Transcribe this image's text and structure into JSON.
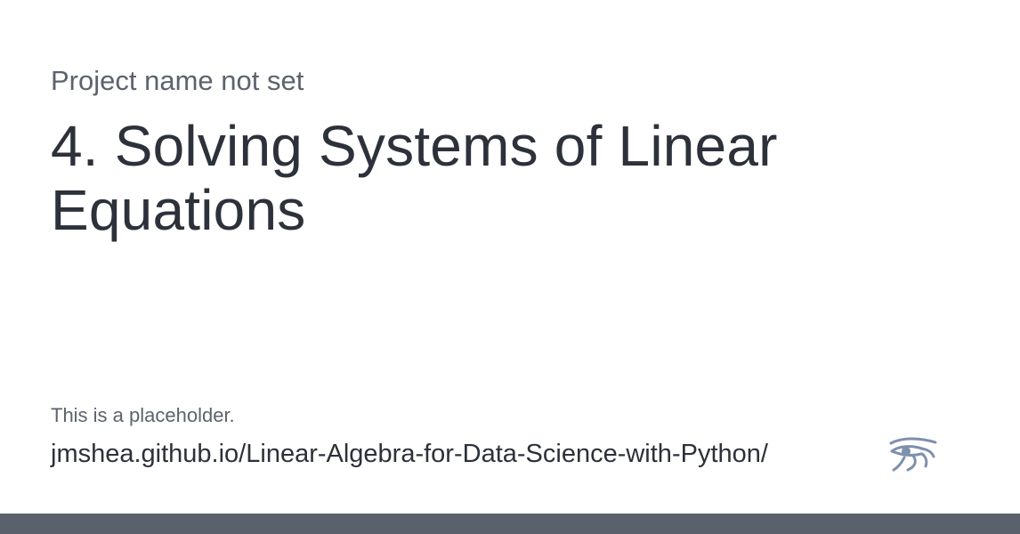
{
  "project": {
    "name": "Project name not set"
  },
  "page": {
    "title": "4. Solving Systems of Linear Equations"
  },
  "footer": {
    "placeholder_text": "This is a placeholder.",
    "url": "jmshea.github.io/Linear-Algebra-for-Data-Science-with-Python/"
  },
  "icons": {
    "logo": "eye-of-horus-icon"
  },
  "colors": {
    "background": "#ffffff",
    "text_primary": "#2c313a",
    "text_secondary": "#5d636d",
    "logo": "#7f8fad",
    "bottom_bar": "#5b616c"
  }
}
